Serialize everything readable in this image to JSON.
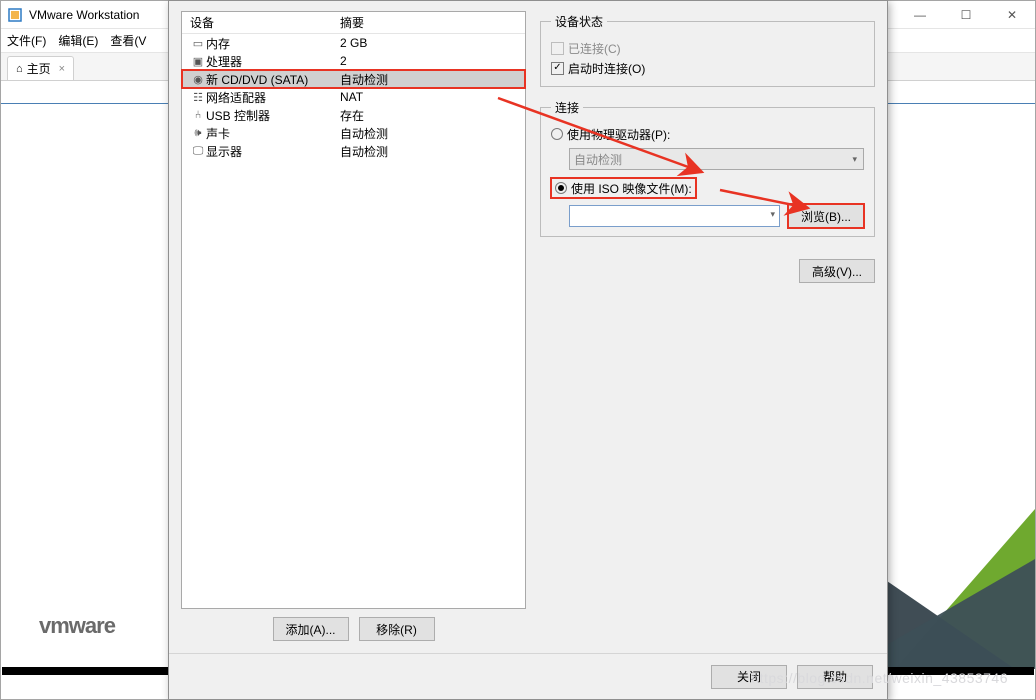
{
  "main_window": {
    "title": "VMware Workstation",
    "menus": [
      "文件(F)",
      "编辑(E)",
      "查看(V"
    ],
    "home_tab": "主页",
    "logo_text": "vmware"
  },
  "win_controls": {
    "min": "—",
    "max": "☐",
    "close": "✕"
  },
  "dialog": {
    "hw_header_device": "设备",
    "hw_header_summary": "摘要",
    "devices": [
      {
        "icon": "▭",
        "name": "内存",
        "summary": "2 GB"
      },
      {
        "icon": "◫",
        "name": "处理器",
        "summary": "2"
      },
      {
        "icon": "◎",
        "name": "新 CD/DVD (SATA)",
        "summary": "自动检测",
        "selected": true,
        "highlight": true
      },
      {
        "icon": "▤",
        "name": "网络适配器",
        "summary": "NAT"
      },
      {
        "icon": "�began",
        "name": "USB 控制器",
        "summary": "存在"
      },
      {
        "icon": "🔊",
        "name": "声卡",
        "summary": "自动检测"
      },
      {
        "icon": "▢",
        "name": "显示器",
        "summary": "自动检测"
      }
    ],
    "add_btn": "添加(A)...",
    "remove_btn": "移除(R)",
    "status_legend": "设备状态",
    "cb_connected": "已连接(C)",
    "cb_connect_on": "启动时连接(O)",
    "conn_legend": "连接",
    "rb_physical": "使用物理驱动器(P):",
    "combo_auto": "自动检测",
    "rb_iso": "使用 ISO 映像文件(M):",
    "browse_btn": "浏览(B)...",
    "advanced_btn": "高级(V)...",
    "close_btn": "关闭",
    "help_btn": "帮助"
  },
  "watermark": "https://blog.csdn.net/weixin_43853746",
  "icons": {
    "home": "⌂",
    "usb": "⑃",
    "display": "🖵",
    "memory": "▭",
    "cpu": "▣",
    "cd": "◉",
    "net": "☷",
    "sound": "🕪"
  }
}
